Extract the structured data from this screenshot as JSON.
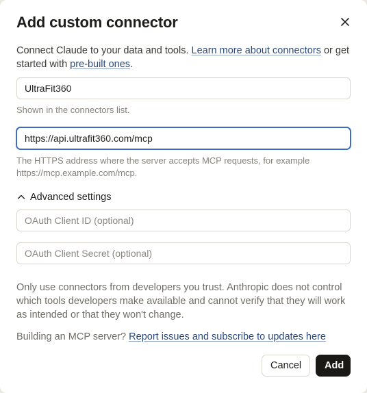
{
  "dialog": {
    "title": "Add custom connector",
    "close_icon": "close-icon",
    "intro": {
      "text_before": "Connect Claude to your data and tools. ",
      "learn_more_link": "Learn more about connectors",
      "text_middle": " or get started with ",
      "prebuilt_link": "pre-built ones",
      "text_after": "."
    },
    "name_field": {
      "value": "UltraFit360",
      "hint": "Shown in the connectors list."
    },
    "url_field": {
      "value": "https://api.ultrafit360.com/mcp",
      "hint": "The HTTPS address where the server accepts MCP requests, for example https://mcp.example.com/mcp."
    },
    "advanced": {
      "label": "Advanced settings",
      "icon": "chevron-up-icon",
      "expanded": true,
      "client_id_placeholder": "OAuth Client ID (optional)",
      "client_secret_placeholder": "OAuth Client Secret (optional)"
    },
    "warning": "Only use connectors from developers you trust. Anthropic does not control which tools developers make available and cannot verify that they will work as intended or that they won't change.",
    "footer": {
      "text": "Building an MCP server? ",
      "link": "Report issues and subscribe to updates here"
    },
    "buttons": {
      "cancel": "Cancel",
      "add": "Add"
    },
    "colors": {
      "link": "#2b4a7a",
      "focus_border": "#3f6fbf",
      "primary_button": "#1a1915"
    }
  }
}
